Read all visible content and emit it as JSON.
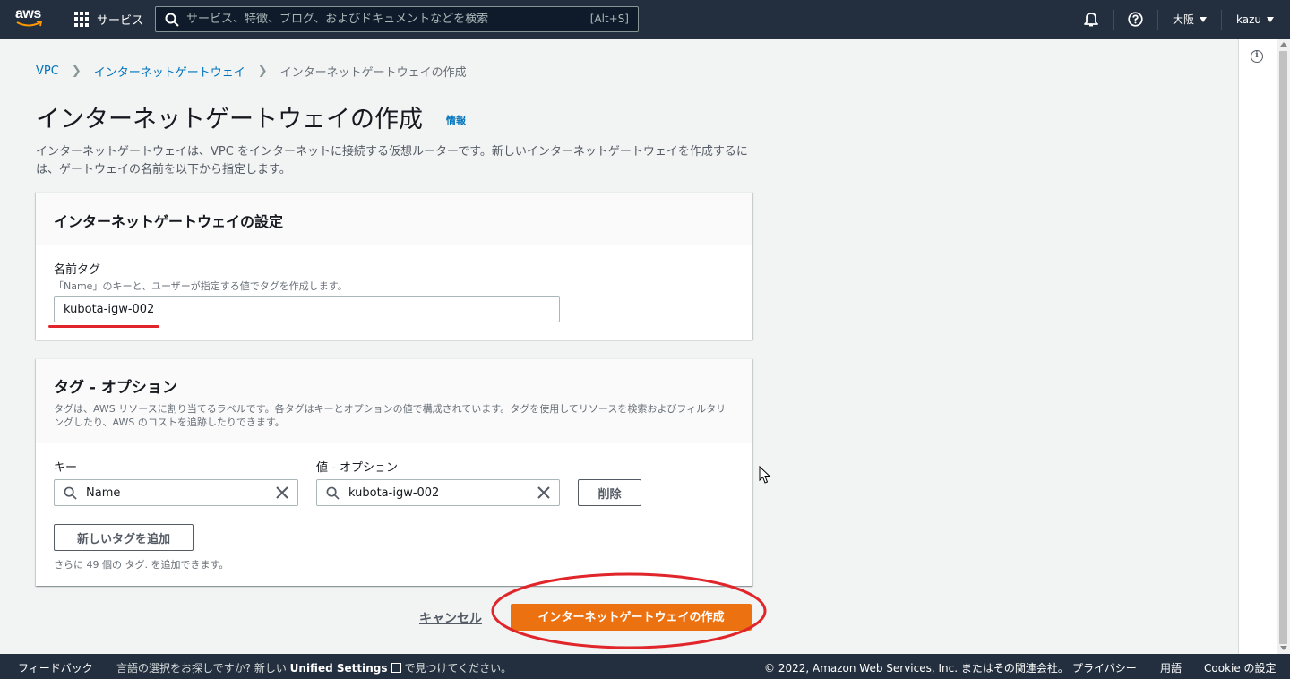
{
  "nav": {
    "logo_text": "aws",
    "services_label": "サービス",
    "search_placeholder": "サービス、特徴、ブログ、およびドキュメントなどを検索",
    "search_shortcut": "[Alt+S]",
    "region": "大阪",
    "user": "kazu"
  },
  "breadcrumb": {
    "items": [
      "VPC",
      "インターネットゲートウェイ"
    ],
    "current": "インターネットゲートウェイの作成"
  },
  "page": {
    "title": "インターネットゲートウェイの作成",
    "info_link": "情報",
    "description": "インターネットゲートウェイは、VPC をインターネットに接続する仮想ルーターです。新しいインターネットゲートウェイを作成するには、ゲートウェイの名前を以下から指定します。"
  },
  "settings": {
    "title": "インターネットゲートウェイの設定",
    "name_tag_label": "名前タグ",
    "name_tag_hint": "「Name」のキーと、ユーザーが指定する値でタグを作成します。",
    "name_tag_value": "kubota-igw-002"
  },
  "tags": {
    "title": "タグ - オプション",
    "description": "タグは、AWS リソースに割り当てるラベルです。各タグはキーとオプションの値で構成されています。タグを使用してリソースを検索およびフィルタリングしたり、AWS のコストを追跡したりできます。",
    "key_label": "キー",
    "value_label": "値 - オプション",
    "rows": [
      {
        "key": "Name",
        "value": "kubota-igw-002",
        "remove_label": "削除"
      }
    ],
    "add_button": "新しいタグを追加",
    "remaining_note": "さらに 49 個の タグ. を追加できます。"
  },
  "actions": {
    "cancel": "キャンセル",
    "create": "インターネットゲートウェイの作成"
  },
  "footer": {
    "feedback": "フィードバック",
    "lang_prompt": "言語の選択をお探しですか? 新しい",
    "unified_settings": "Unified Settings",
    "lang_suffix": "で見つけてください。",
    "copyright": "© 2022, Amazon Web Services, Inc. またはその関連会社。",
    "privacy": "プライバシー",
    "terms": "用語",
    "cookie": "Cookie の設定"
  },
  "colors": {
    "nav_bg": "#232f3e",
    "primary": "#ec7211",
    "link": "#0073bb",
    "annotation_red": "#e0262a"
  }
}
